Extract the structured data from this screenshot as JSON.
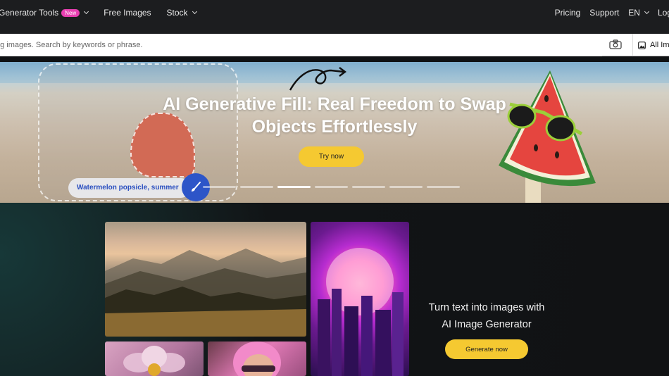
{
  "nav": {
    "generator_tools": "Generator Tools",
    "new_badge": "New",
    "free_images": "Free Images",
    "stock": "Stock",
    "pricing": "Pricing",
    "support": "Support",
    "language": "EN",
    "login": "Log"
  },
  "search": {
    "placeholder": "ng images. Search by keywords or phrase.",
    "filter_label": "All Im"
  },
  "banner": {
    "title_line1": "AI Generative Fill: Real Freedom to Swap",
    "title_line2": "Objects Effortlessly",
    "try_button": "Try now",
    "prompt_pill": "Watermelon popsicle, summer",
    "slide_count": 7,
    "active_slide": 3
  },
  "promo": {
    "line1": "Turn text into images with",
    "line2": "AI Image Generator",
    "button": "Generate now"
  },
  "colors": {
    "accent_yellow": "#f5c931",
    "badge_pink": "#e83fb1",
    "brush_blue": "#2d55c8"
  }
}
